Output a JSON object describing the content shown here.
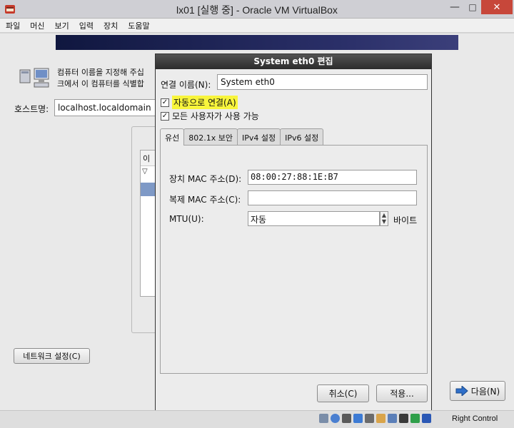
{
  "window": {
    "title": "lx01 [실행 중] - Oracle VM VirtualBox",
    "minimize_symbol": "—",
    "maximize_symbol": "□",
    "close_symbol": "✕"
  },
  "menubar": {
    "items": [
      "파일",
      "머신",
      "보기",
      "입력",
      "장치",
      "도움말"
    ]
  },
  "installer": {
    "description_line1": "컴퓨터 이름을 지정해 주십",
    "description_line2": "크에서 이 컴퓨터를 식별합",
    "hostname_label": "호스트명:",
    "hostname_value": "localhost.localdomain",
    "list_header": "이름",
    "network_button": "네트워크 설정(C)",
    "next_button": "다음(N)"
  },
  "dialog": {
    "title": "System eth0 편집",
    "connection_name_label": "연결 이름(N):",
    "connection_name_value": "System eth0",
    "auto_connect_label": "자동으로 연결(A)",
    "auto_connect_checked": true,
    "all_users_label": "모든 사용자가 사용 가능",
    "all_users_checked": true,
    "check_mark": "✓",
    "tabs": [
      "유선",
      "802.1x 보안",
      "IPv4 설정",
      "IPv6 설정"
    ],
    "active_tab": "유선",
    "mac_label": "장치 MAC 주소(D):",
    "mac_value": "08:00:27:88:1E:B7",
    "clone_mac_label": "복제 MAC 주소(C):",
    "clone_mac_value": "",
    "mtu_label": "MTU(U):",
    "mtu_value": "자동",
    "mtu_unit": "바이트",
    "cancel_button": "취소(C)",
    "apply_button": "적용..."
  },
  "statusbar": {
    "host_key": "Right Control",
    "icons": [
      "hard-disk-icon",
      "optical-drive-icon",
      "audio-icon",
      "network-icon",
      "usb-icon",
      "shared-folders-icon",
      "display-icon",
      "video-capture-icon",
      "virtualization-icon",
      "mouse-integration-icon"
    ]
  },
  "colors": {
    "highlight": "#f8f53c",
    "dialog_title_bg": "#2b2b2b",
    "selection": "#7e99c6",
    "banner": "#1a1f4f"
  }
}
